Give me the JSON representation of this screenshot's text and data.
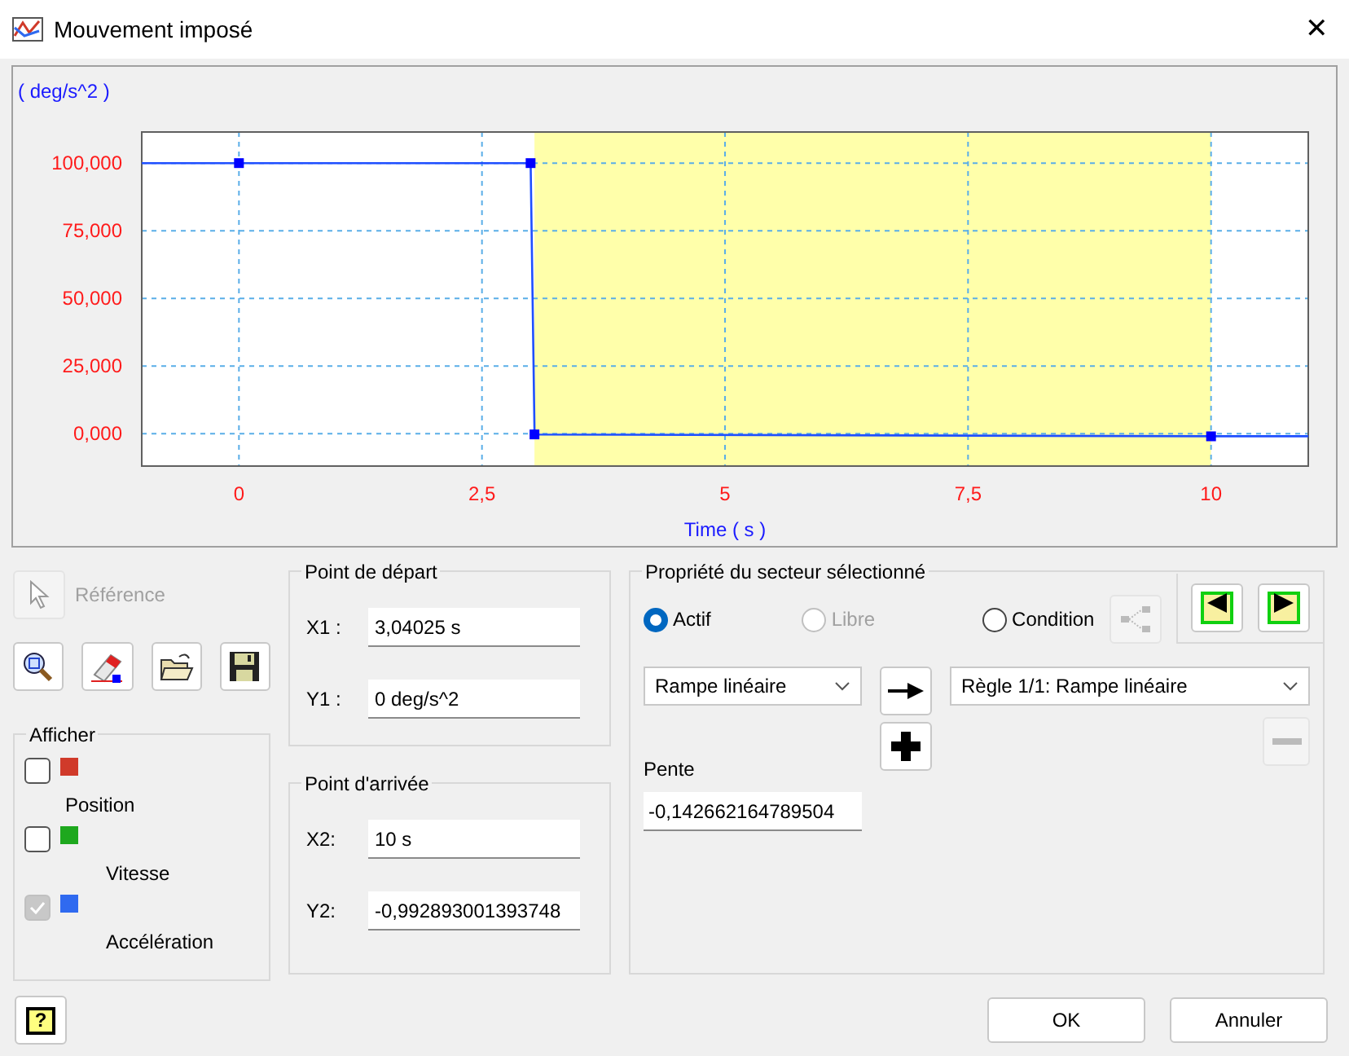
{
  "window": {
    "title": "Mouvement imposé",
    "close": "✕"
  },
  "chart": {
    "unit_label": "( deg/s^2 )",
    "chart_data": {
      "type": "line",
      "xlabel": "Time ( s )",
      "xlim": [
        -1,
        11
      ],
      "ylim": [
        -12,
        111.5
      ],
      "xticks": [
        {
          "value": 0,
          "label": "0"
        },
        {
          "value": 2.5,
          "label": "2,5"
        },
        {
          "value": 5,
          "label": "5"
        },
        {
          "value": 7.5,
          "label": "7,5"
        },
        {
          "value": 10,
          "label": "10"
        }
      ],
      "yticks": [
        {
          "value": 0,
          "label": "0,000"
        },
        {
          "value": 25,
          "label": "25,000"
        },
        {
          "value": 50,
          "label": "50,000"
        },
        {
          "value": 75,
          "label": "75,000"
        },
        {
          "value": 100,
          "label": "100,000"
        }
      ],
      "grid": true,
      "x": [
        -1,
        0,
        3,
        3.04,
        10,
        11
      ],
      "series": [
        {
          "color": "#1f4fff",
          "values": [
            100,
            100,
            100,
            -0.3,
            -1,
            -1
          ]
        }
      ]
    },
    "sectors": [
      {
        "selected": false
      },
      {
        "selected": false
      },
      {
        "selected": true
      }
    ]
  },
  "reference": {
    "label": "Référence",
    "disabled": true
  },
  "tools": [
    {
      "kind": "zoom"
    },
    {
      "kind": "eraser"
    },
    {
      "kind": "open"
    },
    {
      "kind": "save"
    }
  ],
  "display": {
    "title": "Afficher",
    "items": [
      {
        "label": "Position",
        "checked": false,
        "disabled": false,
        "color": "#d03a2a"
      },
      {
        "label": "Vitesse",
        "checked": false,
        "disabled": false,
        "color": "#1ea81e"
      },
      {
        "label": "Accélération",
        "checked": true,
        "disabled": true,
        "color": "#2f6af0"
      }
    ]
  },
  "start_point": {
    "title": "Point de départ",
    "fields": [
      {
        "label": "X1 :",
        "value": "3,04025 s"
      },
      {
        "label": "Y1 :",
        "value": "0 deg/s^2"
      }
    ]
  },
  "end_point": {
    "title": "Point d'arrivée",
    "fields": [
      {
        "label": "X2:",
        "value": "10 s"
      },
      {
        "label": "Y2:",
        "value": "-0,992893001393748"
      }
    ]
  },
  "sector": {
    "title": "Propriété du secteur sélectionné",
    "radios": [
      {
        "label": "Actif",
        "selected": true,
        "disabled": false
      },
      {
        "label": "Libre",
        "selected": false,
        "disabled": true
      },
      {
        "label": "Condition",
        "selected": false,
        "disabled": false
      }
    ],
    "tree_button": {
      "disabled": true
    },
    "law": "Rampe linéaire",
    "rule": "Règle 1/1: Rampe linéaire",
    "add": {
      "disabled": false
    },
    "remove": {
      "disabled": true
    },
    "slope_label": "Pente",
    "slope_value": "-0,142662164789504"
  },
  "buttons": {
    "help": "?",
    "ok": "OK",
    "cancel": "Annuler"
  }
}
